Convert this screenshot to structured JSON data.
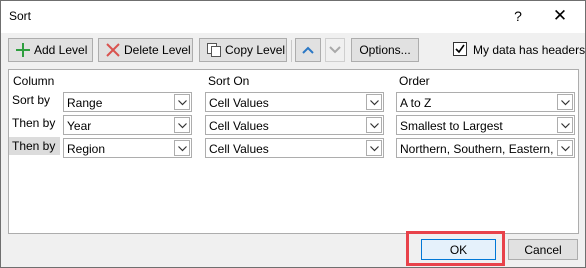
{
  "window": {
    "title": "Sort",
    "help_label": "?",
    "close_label": "✕"
  },
  "toolbar": {
    "add_level": "Add Level",
    "delete_level": "Delete Level",
    "copy_level": "Copy Level",
    "options": "Options...",
    "headers_label": "My data has headers",
    "headers_checked": true
  },
  "grid": {
    "headers": {
      "column": "Column",
      "sort_on": "Sort On",
      "order": "Order"
    },
    "rows": [
      {
        "label": "Sort by",
        "column": "Range",
        "sort_on": "Cell Values",
        "order": "A to Z"
      },
      {
        "label": "Then by",
        "column": "Year",
        "sort_on": "Cell Values",
        "order": "Smallest to Largest"
      },
      {
        "label": "Then by",
        "column": "Region",
        "sort_on": "Cell Values",
        "order": "Northern, Southern, Eastern, W"
      }
    ]
  },
  "buttons": {
    "ok": "OK",
    "cancel": "Cancel"
  },
  "colors": {
    "accent": "#0078d7",
    "highlight": "#e8424a",
    "add_icon": "#2e9e3f",
    "delete_icon": "#d9534f",
    "arrow_up": "#2b78c5"
  }
}
